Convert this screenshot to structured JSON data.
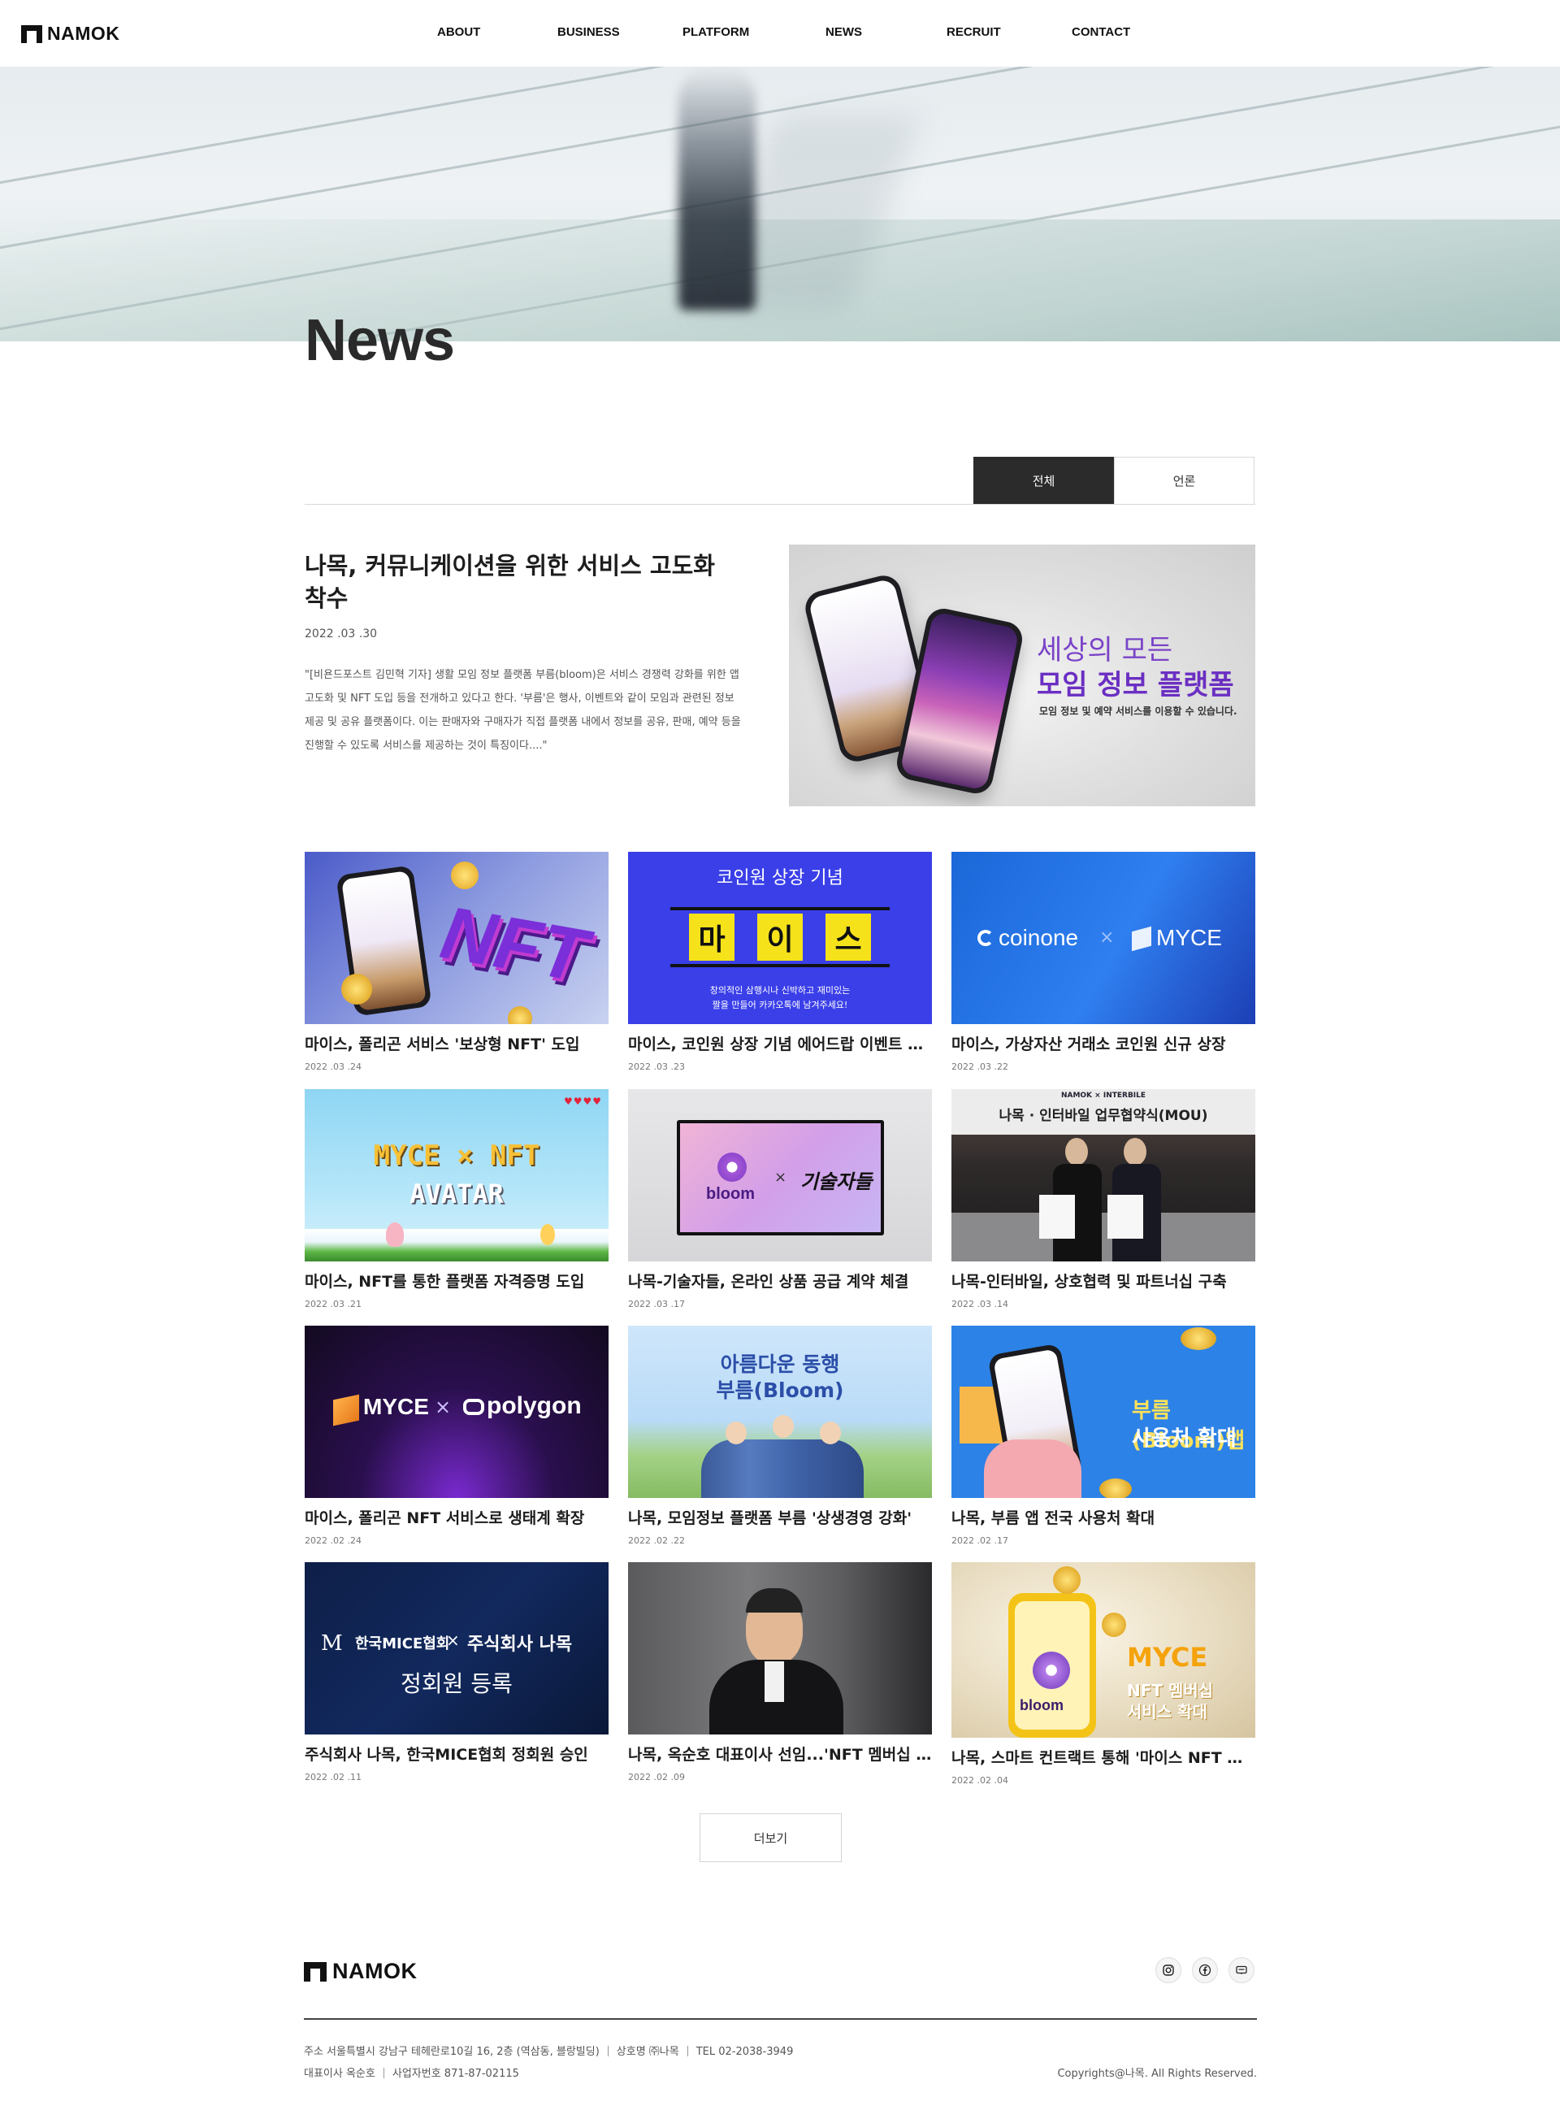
{
  "header": {
    "logo_text": "NAMOK",
    "nav": [
      "ABOUT",
      "BUSINESS",
      "PLATFORM",
      "NEWS",
      "RECRUIT",
      "CONTACT"
    ]
  },
  "hero": {
    "title": "News"
  },
  "tabs": [
    {
      "label": "전체",
      "active": true
    },
    {
      "label": "언론",
      "active": false
    }
  ],
  "featured": {
    "title": "나목, 커뮤니케이션을 위한 서비스 고도화 착수",
    "date": "2022 .03 .30",
    "body": "\"[비욘드포스트 김민혁 기자] 생활 모임 정보 플랫폼 부름(bloom)은 서비스 경쟁력 강화를 위한 앱 고도화 및 NFT 도입 등을 전개하고 있다고 한다. '부름'은 행사, 이벤트와 같이 모임과 관련된 정보 제공 및 공유 플랫폼이다. 이는 판매자와 구매자가 직접 플랫폼 내에서 정보를 공유, 판매, 예약 등을 진행할 수 있도록 서비스를 제공하는 것이 특징이다....\"",
    "image": {
      "headline1": "세상의 모든",
      "headline2": "모임 정보 플랫폼",
      "headline3": "모임 정보 및 예약 서비스를 이용할 수 있습니다."
    }
  },
  "articles": [
    {
      "title": "마이스, 폴리곤 서비스 '보상형 NFT' 도입",
      "date": "2022 .03 .24",
      "thumb": {
        "text1": "NFT"
      }
    },
    {
      "title": "마이스, 코인원 상장 기념 에어드랍 이벤트 진행",
      "date": "2022 .03 .23",
      "thumb": {
        "text1": "코인원 상장 기념",
        "text2": "마",
        "text3": "이",
        "text4": "스",
        "text5": "창의적인 삼행시나 신박하고 재미있는",
        "text6": "짤을 만들어 카카오톡에 남겨주세요!"
      }
    },
    {
      "title": "마이스, 가상자산 거래소 코인원 신규 상장",
      "date": "2022 .03 .22",
      "thumb": {
        "text1": "coinone",
        "text2": "×",
        "text3": "MYCE"
      }
    },
    {
      "title": "마이스, NFT를 통한 플랫폼 자격증명 도입",
      "date": "2022 .03 .21",
      "thumb": {
        "text1": "MYCE × NFT",
        "text2": "AVATAR"
      }
    },
    {
      "title": "나목-기술자들, 온라인 상품 공급 계약 체결",
      "date": "2022 .03 .17",
      "thumb": {
        "text1": "bloom",
        "text2": "×",
        "text3": "기술자들"
      }
    },
    {
      "title": "나목-인터바일, 상호협력 및 파트너십 구축",
      "date": "2022 .03 .14",
      "thumb": {
        "text1": "NAMOK × INTERBILE",
        "text2": "나목 · 인터바일 업무협약식(MOU)"
      }
    },
    {
      "title": "마이스, 폴리곤 NFT 서비스로 생태계 확장",
      "date": "2022 .02 .24",
      "thumb": {
        "text1": "MYCE",
        "text2": "×",
        "text3": "polygon"
      }
    },
    {
      "title": "나목, 모임정보 플랫폼 부름 '상생경영 강화'",
      "date": "2022 .02 .22",
      "thumb": {
        "text1": "아름다운 동행",
        "text2": "부름(Bloom)"
      }
    },
    {
      "title": "나목, 부름 앱 전국 사용처 확대",
      "date": "2022 .02 .17",
      "thumb": {
        "text1": "부름(Bloom)앱",
        "text2": "사용처 확대"
      }
    },
    {
      "title": "주식회사 나목, 한국MICE협회 정회원 승인",
      "date": "2022 .02 .11",
      "thumb": {
        "text1": "한국MICE협회",
        "text2": "×",
        "text3": "주식회사 나목",
        "text4": "정회원 등록"
      }
    },
    {
      "title": "나목, 옥순호 대표이사 선임...'NFT 멤버십 서비스 확대'",
      "date": "2022 .02 .09",
      "thumb": {}
    },
    {
      "title": "나목, 스마트 컨트랙트 통해 '마이스 NFT 멤버십 서비스 확대'",
      "date": "2022 .02 .04",
      "thumb": {
        "text1": "MYCE",
        "text2": "NFT 멤버십",
        "text3": "서비스 확대",
        "text4": "bloom"
      }
    }
  ],
  "more_button": "더보기",
  "footer": {
    "logo_text": "NAMOK",
    "social": [
      "instagram-icon",
      "facebook-icon",
      "blog-icon"
    ],
    "address": "주소 서울특별시 강남구 테헤란로10길 16, 2층 (역삼동, 블랑빌딩)",
    "company": "상호명 ㈜나목",
    "tel": "TEL 02-2038-3949",
    "ceo": "대표이사 옥순호",
    "biz_no": "사업자번호 871-87-02115",
    "copyright": "Copyrights@나목. All Rights Reserved."
  }
}
